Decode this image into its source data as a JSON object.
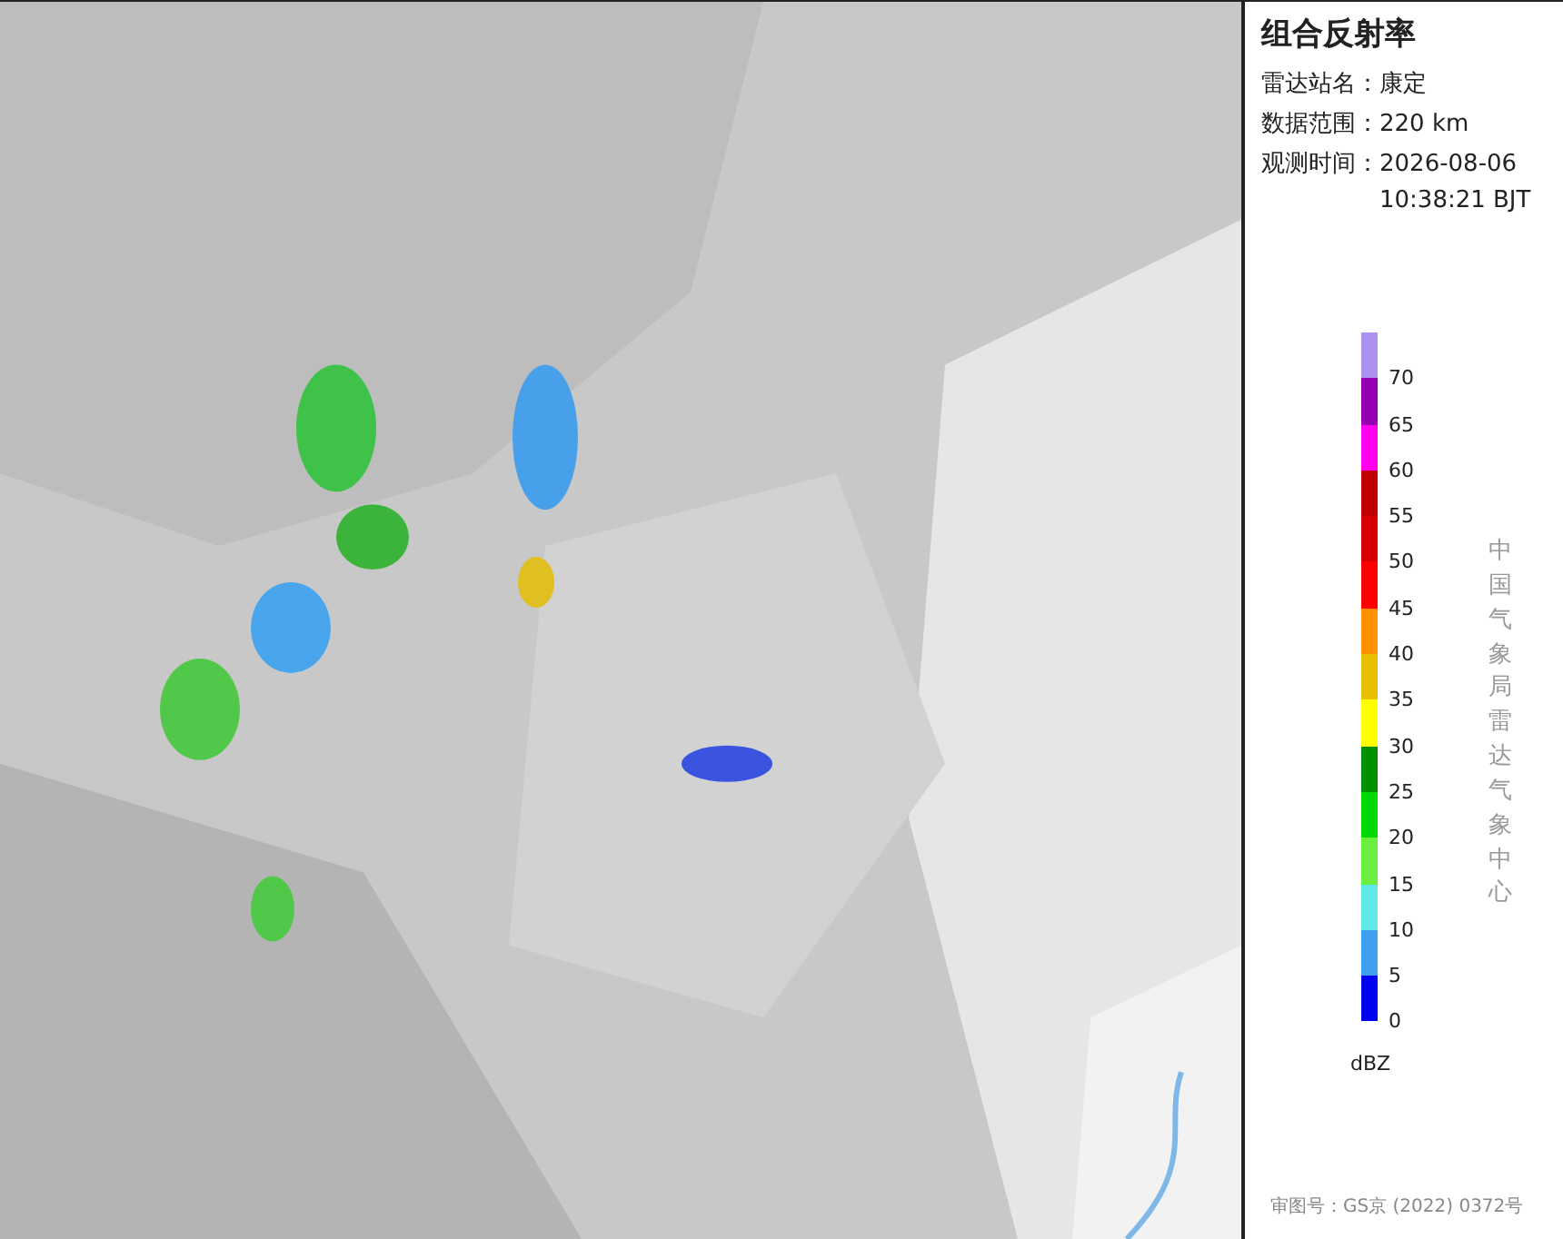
{
  "panel": {
    "title": "组合反射率",
    "fields": [
      {
        "label": "雷达站名：",
        "value": "康定"
      },
      {
        "label": "数据范围：",
        "value": "220 km"
      },
      {
        "label": "观测时间：",
        "value": "2026-08-06 10:38:21 BJT"
      }
    ],
    "legend": [
      {
        "label": "70",
        "color": "#ad90f0"
      },
      {
        "label": "65",
        "color": "#9600b4"
      },
      {
        "label": "60",
        "color": "#ff00f0"
      },
      {
        "label": "55",
        "color": "#c00000"
      },
      {
        "label": "50",
        "color": "#d60000"
      },
      {
        "label": "45",
        "color": "#ff0000"
      },
      {
        "label": "40",
        "color": "#ff9000"
      },
      {
        "label": "35",
        "color": "#e8c000"
      },
      {
        "label": "30",
        "color": "#ffff00"
      },
      {
        "label": "25",
        "color": "#009000"
      },
      {
        "label": "20",
        "color": "#00d800"
      },
      {
        "label": "15",
        "color": "#6cf040"
      },
      {
        "label": "10",
        "color": "#60e8e8"
      },
      {
        "label": "5",
        "color": "#40a0f0"
      },
      {
        "label": "0",
        "color": "#0000f0"
      }
    ],
    "unit": "dBZ",
    "credit": "中国气象局雷达气象中心",
    "approval": "审图号：GS京 (2022) 0372号"
  }
}
